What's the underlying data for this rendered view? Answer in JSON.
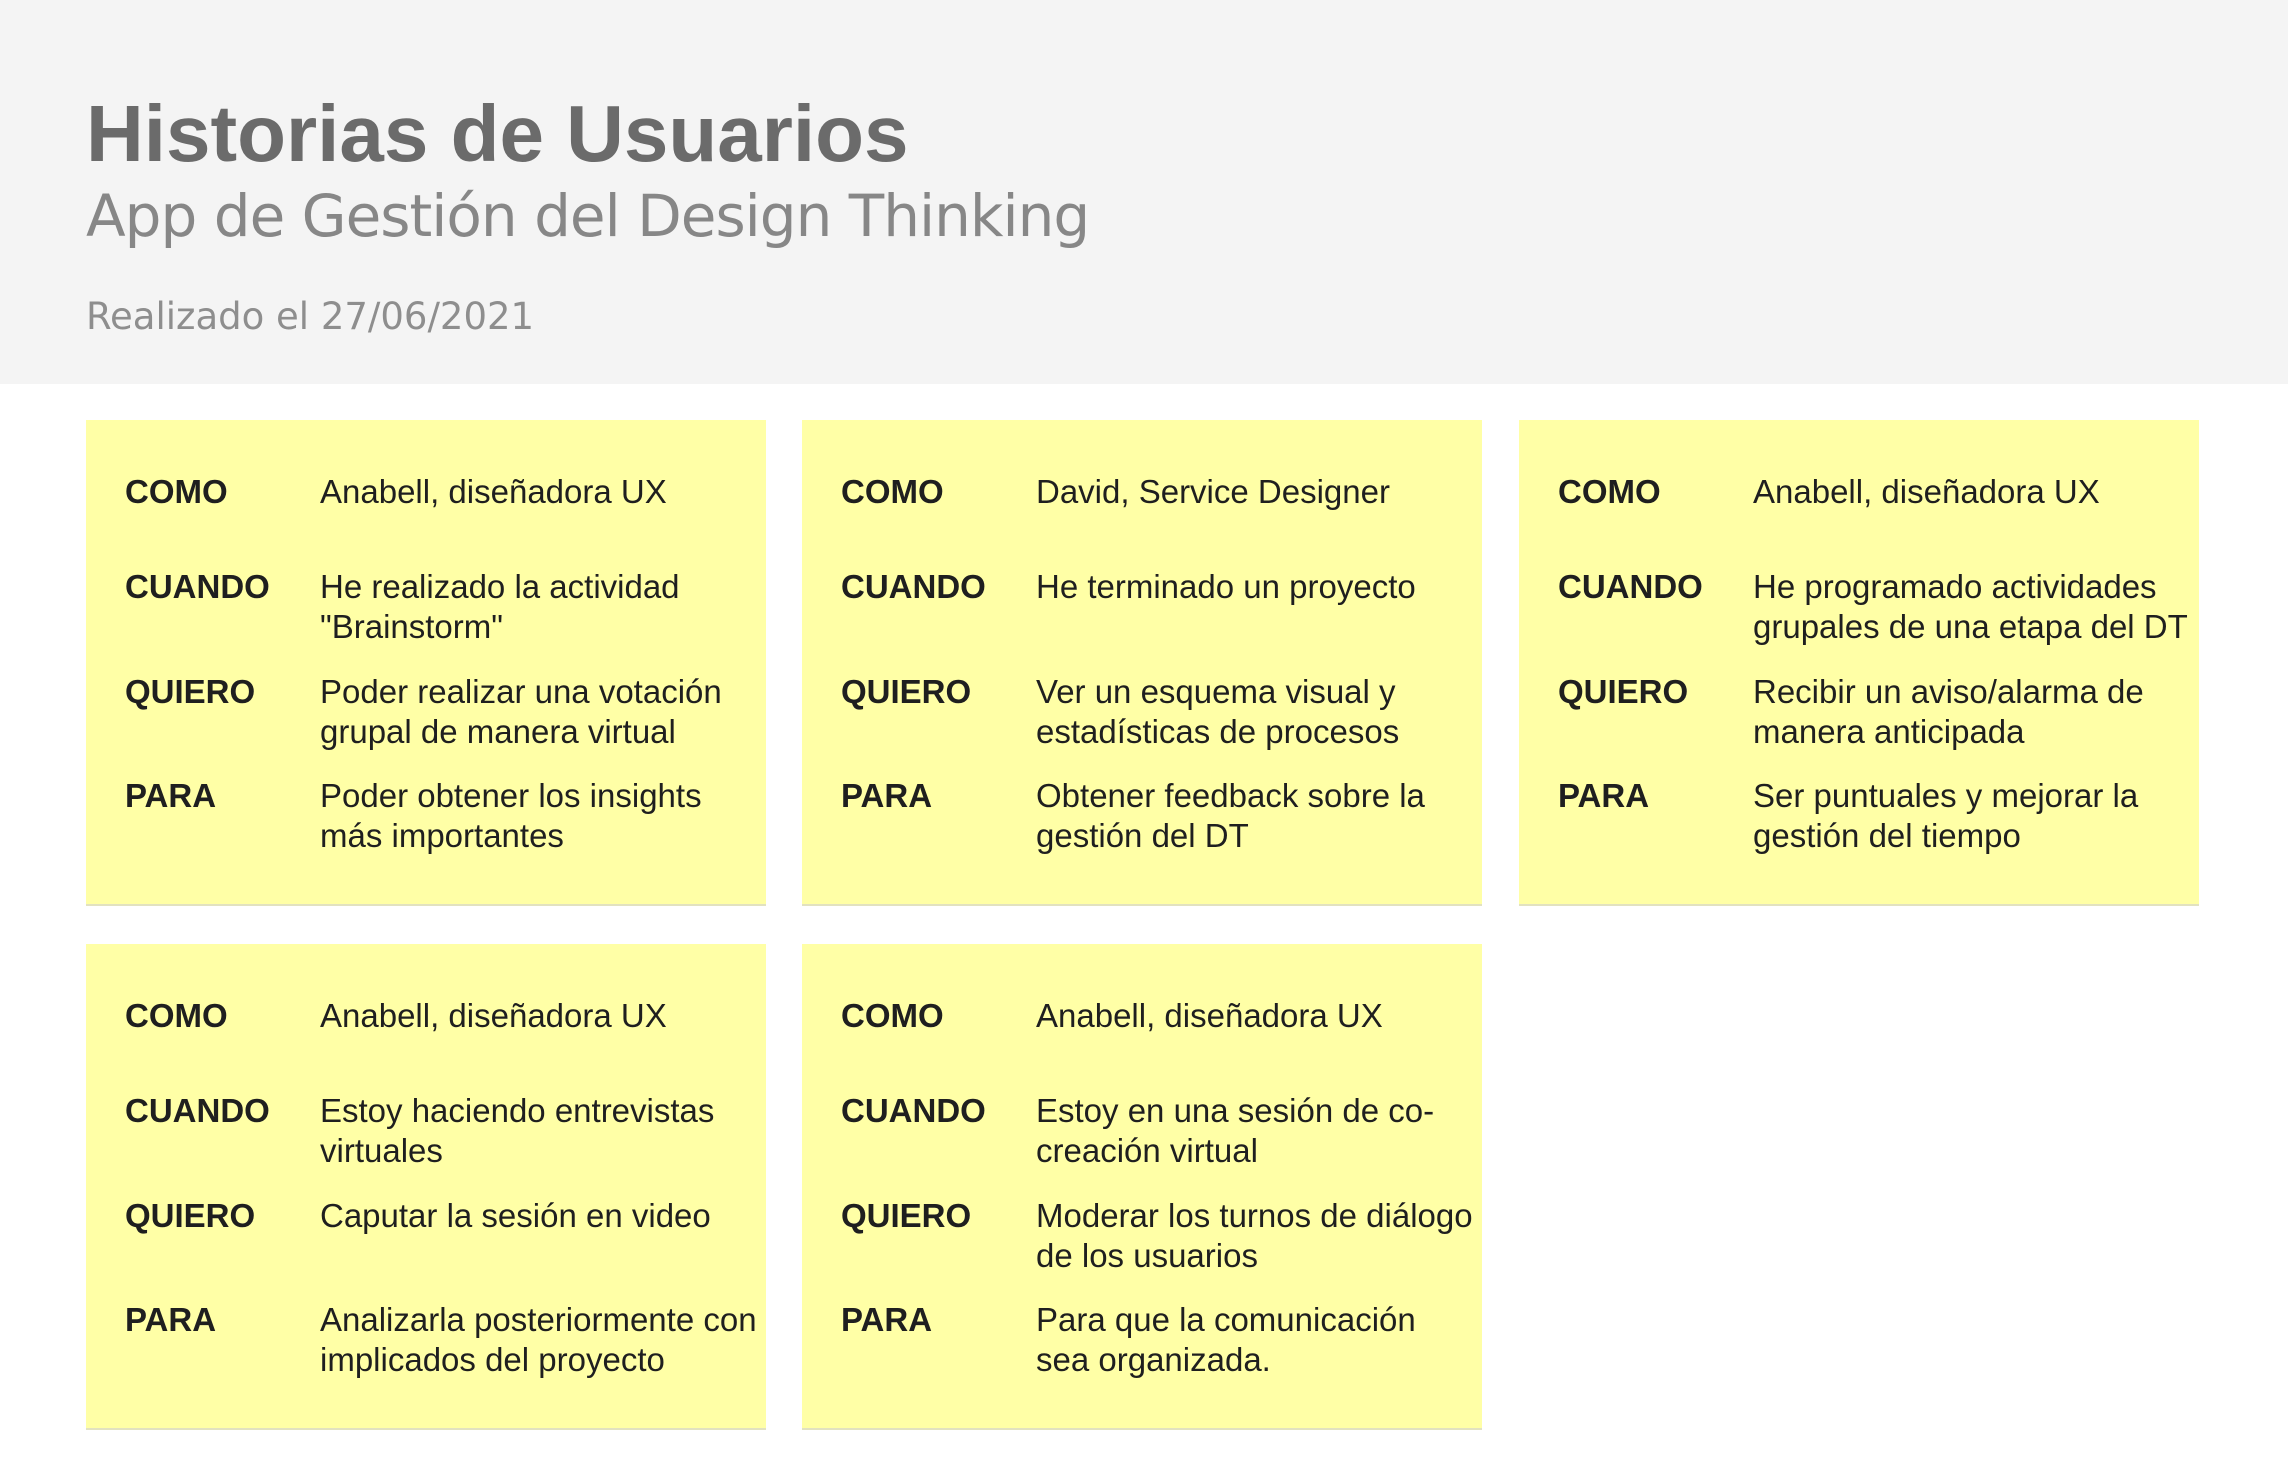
{
  "header": {
    "title": "Historias de Usuarios",
    "subtitle": "App de Gestión del Design Thinking",
    "date": "Realizado el 27/06/2021"
  },
  "labels": {
    "como": "COMO",
    "cuando": "CUANDO",
    "quiero": "QUIERO",
    "para": "PARA"
  },
  "cards": [
    {
      "como": "Anabell, diseñadora UX",
      "cuando": "He realizado la actividad \"Brainstorm\"",
      "quiero": "Poder realizar una votación grupal de manera virtual",
      "para": "Poder obtener los insights más importantes"
    },
    {
      "como": "David, Service Designer",
      "cuando": "He terminado un proyecto",
      "quiero": "Ver un esquema visual y estadísticas de procesos",
      "para": "Obtener feedback sobre la gestión del DT"
    },
    {
      "como": "Anabell, diseñadora UX",
      "cuando": "He programado actividades grupales de una etapa del DT",
      "quiero": "Recibir un aviso/alarma de manera anticipada",
      "para": "Ser puntuales y mejorar la gestión del tiempo"
    },
    {
      "como": "Anabell, diseñadora UX",
      "cuando": "Estoy haciendo entrevistas virtuales",
      "quiero": "Caputar la sesión en video",
      "para": "Analizarla posteriormente con implicados del proyecto"
    },
    {
      "como": "Anabell, diseñadora UX",
      "cuando": "Estoy en una sesión de co-creación virtual",
      "quiero": "Moderar los turnos de diálogo de los usuarios",
      "para": "Para que la comunicación sea organizada."
    }
  ],
  "colors": {
    "header_bg": "#f4f4f4",
    "card_bg": "#ffffa6",
    "title": "#6b6b6b",
    "text": "#1f1f1f"
  }
}
